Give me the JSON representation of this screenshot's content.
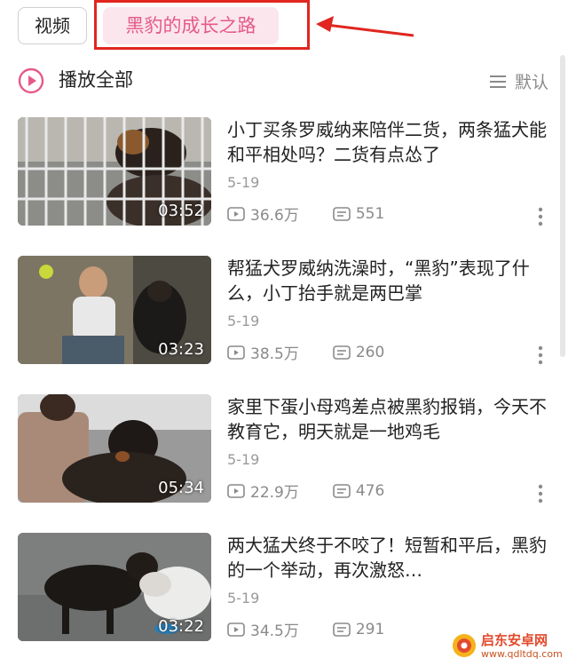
{
  "tabs": {
    "video": "视频",
    "collection": "黑豹的成长之路"
  },
  "header": {
    "play_all": "播放全部",
    "sort": "默认"
  },
  "videos": [
    {
      "title": "小丁买条罗威纳来陪伴二货，两条猛犬能和平相处吗？二货有点怂了",
      "date": "5-19",
      "views": "36.6万",
      "comments": "551",
      "duration": "03:52"
    },
    {
      "title": "帮猛犬罗威纳洗澡时，“黑豹”表现了什么，小丁抬手就是两巴掌",
      "date": "5-19",
      "views": "38.5万",
      "comments": "260",
      "duration": "03:23"
    },
    {
      "title": "家里下蛋小母鸡差点被黑豹报销，今天不教育它，明天就是一地鸡毛",
      "date": "5-19",
      "views": "22.9万",
      "comments": "476",
      "duration": "05:34"
    },
    {
      "title": "两大猛犬终于不咬了！短暂和平后，黑豹的一个举动，再次激怒…",
      "date": "5-19",
      "views": "34.5万",
      "comments": "291",
      "duration": "03:22"
    }
  ],
  "watermark": {
    "name": "启东安卓网",
    "url": "www.qdltdq.com"
  },
  "colors": {
    "accent": "#e55a87",
    "accent_bg": "#fbe6ee",
    "annotation": "#e0261f",
    "meta": "#8a8a8a"
  }
}
